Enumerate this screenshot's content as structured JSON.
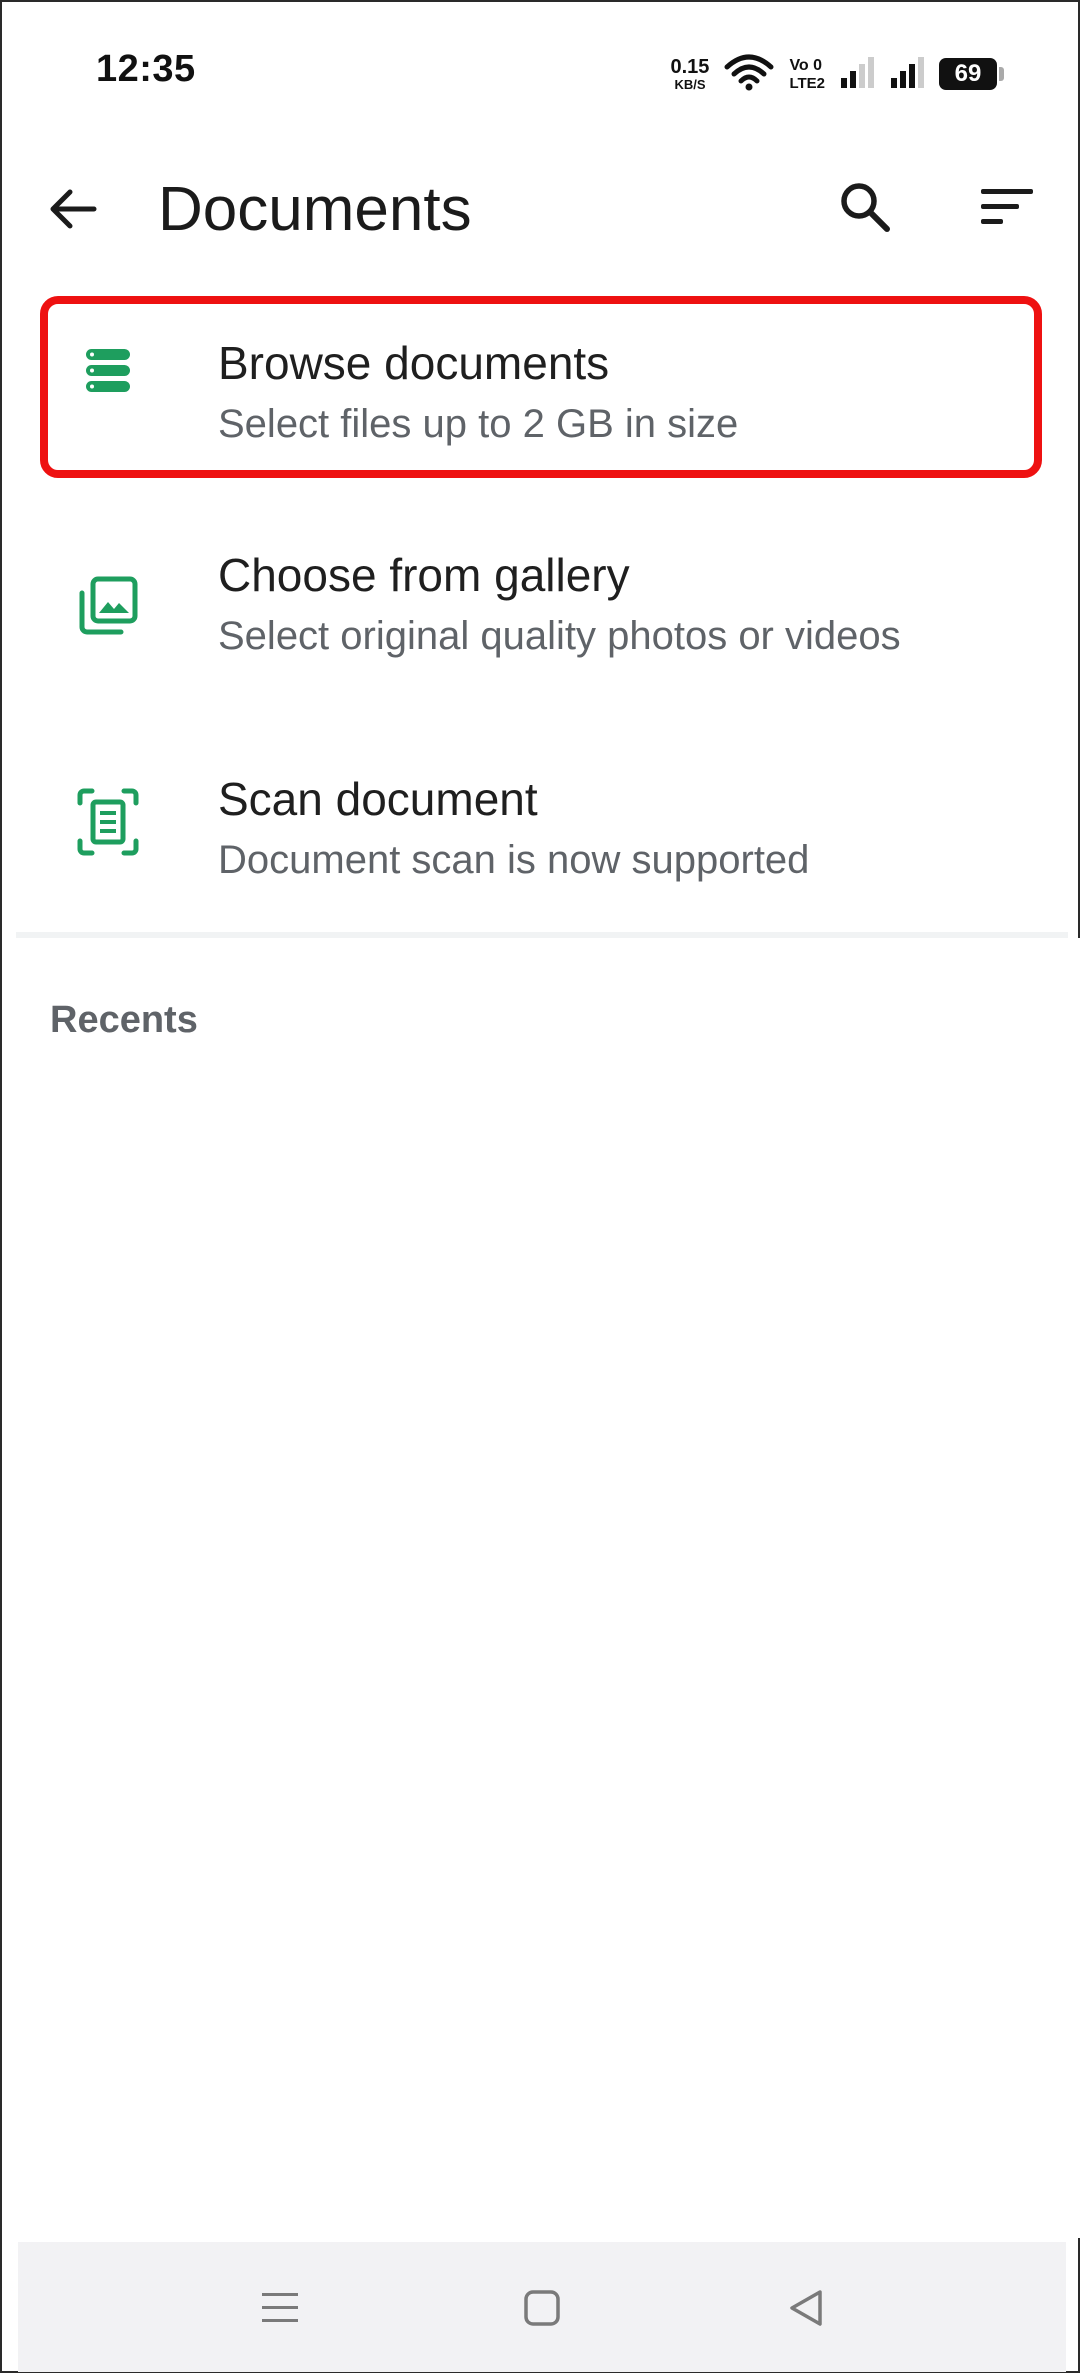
{
  "status_bar": {
    "time": "12:35",
    "net_speed_value": "0.15",
    "net_speed_unit": "KB/S",
    "volte_top": "Vo 0",
    "volte_bottom": "LTE2",
    "battery": "69",
    "icons": [
      "wifi-icon",
      "signal-icon",
      "signal-icon",
      "battery-icon"
    ]
  },
  "app_bar": {
    "title": "Documents",
    "icons": [
      "back-arrow-icon",
      "search-icon",
      "sort-icon"
    ]
  },
  "items": [
    {
      "title": "Browse documents",
      "subtitle": "Select files up to 2 GB in size",
      "icon": "documents-stack-icon"
    },
    {
      "title": "Choose from gallery",
      "subtitle": "Select original quality photos or videos",
      "icon": "gallery-icon"
    },
    {
      "title": "Scan document",
      "subtitle": "Document scan is now supported",
      "icon": "scan-document-icon"
    }
  ],
  "recents": {
    "heading": "Recents"
  },
  "nav_bar": {
    "icons": [
      "menu-icon",
      "home-icon",
      "back-icon"
    ]
  },
  "colors": {
    "accent_green": "#1e9e5e",
    "highlight_red": "#ee1111",
    "title_text": "#1f1f1f",
    "secondary_text": "#5f6368"
  }
}
